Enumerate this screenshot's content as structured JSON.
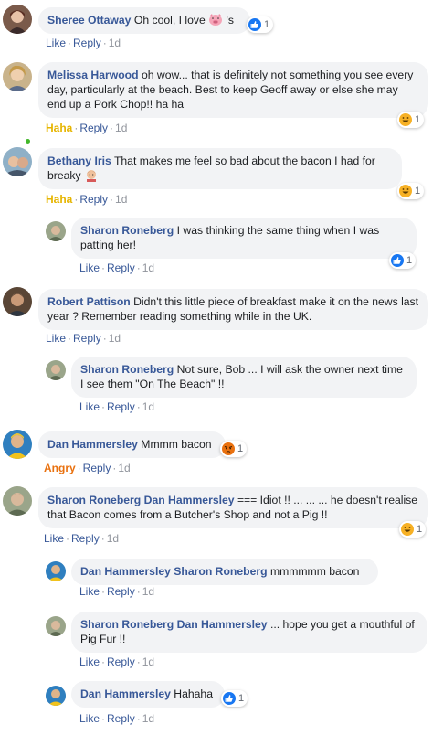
{
  "actions": {
    "like": "Like",
    "reply": "Reply",
    "haha": "Haha",
    "angry": "Angry",
    "sep": "·"
  },
  "comments": [
    {
      "author": "Sheree Ottaway",
      "text": "Oh cool, I love ",
      "text_after": " 's",
      "time": "1d",
      "reaction_count": "1",
      "reaction": "like-icon"
    },
    {
      "author": "Melissa Harwood",
      "text": "oh wow... that is definitely not something you see every day, particularly at the beach. Best to keep Geoff away or else she may end up a Pork Chop!! ha ha",
      "time": "1d",
      "reaction_count": "1",
      "reaction": "haha-icon"
    },
    {
      "author": "Bethany Iris",
      "text": "That makes me feel so bad about the bacon I had for breaky ",
      "time": "1d",
      "reaction_count": "1",
      "reaction": "haha-icon"
    },
    {
      "author": "Sharon Roneberg",
      "text": "I was thinking the same thing when I was patting her!",
      "time": "1d",
      "reaction_count": "1",
      "reaction": "like-icon"
    },
    {
      "author": "Robert Pattison",
      "text": "Didn't this little piece of breakfast make it on the news last year ? Remember reading something while in the UK.",
      "time": "1d"
    },
    {
      "author": "Sharon Roneberg",
      "text": "Not sure, Bob ... I will ask the owner next time I see them \"On The Beach\" !!",
      "time": "1d"
    },
    {
      "author": "Dan Hammersley",
      "text": "Mmmm bacon",
      "time": "1d",
      "reaction_count": "1",
      "reaction": "angry-icon"
    },
    {
      "author": "Sharon Roneberg",
      "tag": "Dan Hammersley",
      "text": "=== Idiot !! ... ... ... he doesn't realise that Bacon comes from a Butcher's Shop and not a Pig !!",
      "time": "1d",
      "reaction_count": "1",
      "reaction": "haha-icon"
    },
    {
      "author": "Dan Hammersley",
      "tag": "Sharon Roneberg",
      "text": "mmmmmm bacon",
      "time": "1d"
    },
    {
      "author": "Sharon Roneberg",
      "tag": "Dan Hammersley",
      "text": "... hope you get a mouthful of Pig Fur !!",
      "time": "1d"
    },
    {
      "author": "Dan Hammersley",
      "text": "Hahaha",
      "time": "1d",
      "reaction_count": "1",
      "reaction": "like-icon"
    }
  ],
  "colors": {
    "link": "#385898",
    "bubble": "#f2f3f5",
    "haha": "#e6b500",
    "angry": "#e9710f",
    "like": "#1877f2"
  }
}
